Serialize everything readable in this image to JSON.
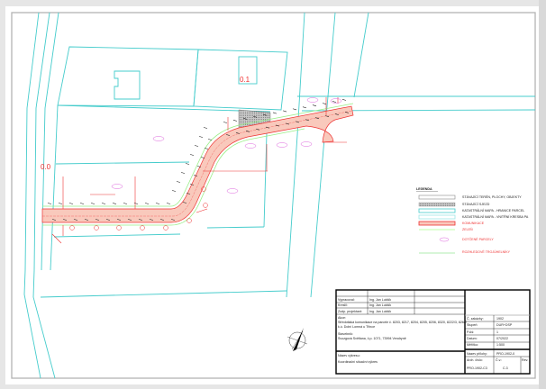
{
  "drawing": {
    "labels": {
      "object_01": "0.1",
      "object_00": "0.0"
    }
  },
  "legend": {
    "title": "LEGENDA",
    "items": [
      {
        "label": "STÁVAJÍCÍ TERÉN, PLOCHY, OBJEKTY",
        "color": "#888888"
      },
      {
        "label": "STÁVAJÍCÍ SJEZD",
        "color": "#888888"
      },
      {
        "label": "KATASTRÁLNÍ MAPA - HRANICE PARCEL",
        "color": "#45cccc"
      },
      {
        "label": "KATASTRÁLNÍ MAPA - VNITŘNÍ KRESBA PA",
        "color": "#9ee6e6"
      },
      {
        "label": "KOMUNIKACE",
        "color": "#ee3333"
      },
      {
        "label": "ZELEŇ",
        "color": "#ccffbb"
      },
      {
        "label": "DOTČENÉ PARCELY",
        "color": "#dd66dd"
      },
      {
        "label": "ROZHLEDOVÉ TROJÚHELNÍKY",
        "color": "#66dd66"
      }
    ]
  },
  "title_block": {
    "vypracoval_label": "Vypracoval:",
    "vypracoval": "Ing. Jan Lukšík",
    "kreslil_label": "Kreslil:",
    "kreslil": "Ing. Jan Lukšík",
    "zodp_label": "Zodp. projektant:",
    "zodp": "Ing. Jan Lukšík",
    "akce_label": "Akce:",
    "akce_line1": "Středotlaká komunikace na parcele č. 8203, 8217, 8204, 8205, 8206, 8320, 8222/3, 826/2",
    "akce_line2": "k.ú. Dolní Lomná u Třince",
    "stavebnik_label": "Stavebník:",
    "stavebnik": "Svozgová Světlana, č.p. 1071, 73994 Vendryně",
    "nazev_label": "Název výkresu:",
    "nazev": "Koordinační situační výkres",
    "zakazka_label": "Č. zakázky:",
    "zakazka": "1902",
    "stupen_label": "Stupeň:",
    "stupen": "DUR+DSP",
    "pare_label": "P.Aš:",
    "pare": "1",
    "datum_label": "Datum:",
    "datum": "07/2022",
    "meritko_label": "Měřítko:",
    "meritko": "1:500",
    "archiv_label": "Nazev přílohy:",
    "archiv": "PRO-1902-0",
    "arch_cislo_label": "Arch. číslo:",
    "arch_cislo": "PRO-1902-C3",
    "cv_label": "Č.v.:",
    "cv": "C.3",
    "rev_label": "Rev."
  }
}
